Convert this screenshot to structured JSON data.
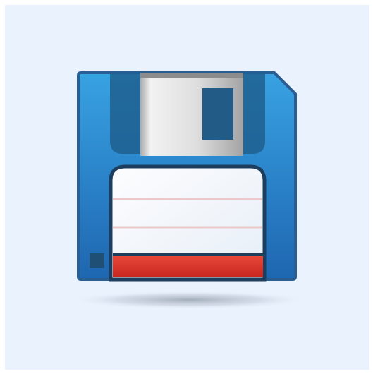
{
  "icon": {
    "name": "floppy-disk",
    "colors": {
      "background": "#eaf2fe",
      "body_light": "#38a2e2",
      "body_dark": "#1e66b0",
      "outline": "#2a5d91",
      "shutter_light": "#f0f0f0",
      "shutter_dark": "#a9a9a9",
      "shutter_window": "#215b86",
      "label_paper": "#f4f7fb",
      "label_lines": "#e9c9c9",
      "label_stripe": "#e0342f",
      "write_protect": "#1f4f74",
      "shadow": "#8d98a6"
    }
  }
}
